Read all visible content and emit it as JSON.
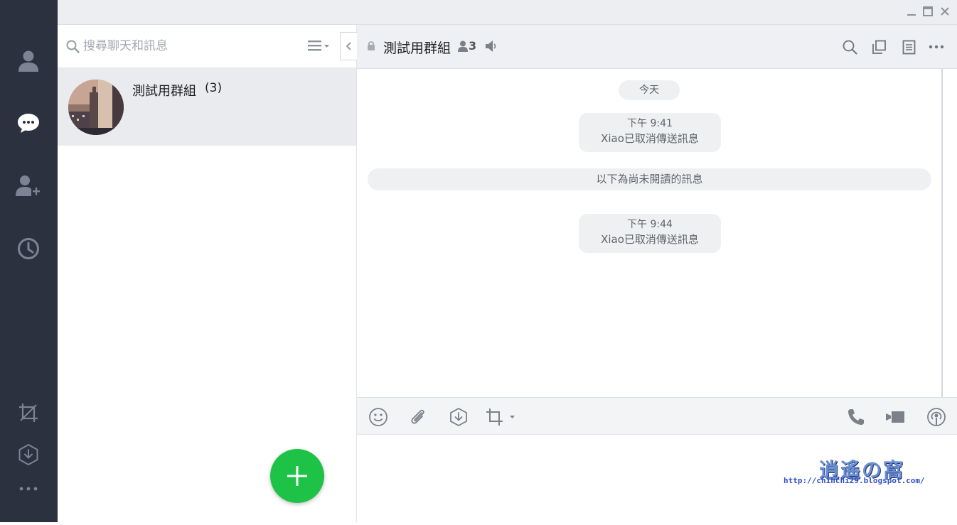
{
  "colors": {
    "sidebar_bg": "#2c3140",
    "sidebar_icon": "#7d8393",
    "sidebar_icon_active": "#ffffff",
    "fab_green": "#1dc247",
    "selected_row": "#e9ebee",
    "system_bubble": "#eef0f2"
  },
  "sidebar": {
    "items": [
      {
        "icon": "friends-icon",
        "active": false
      },
      {
        "icon": "chat-bubble-icon",
        "active": true
      },
      {
        "icon": "add-friend-icon",
        "active": false
      },
      {
        "icon": "clock-icon",
        "active": false
      }
    ],
    "bottom_items": [
      {
        "icon": "crop-capture-icon"
      },
      {
        "icon": "keep-download-icon"
      },
      {
        "icon": "more-dots-icon"
      }
    ]
  },
  "window": {
    "buttons": [
      "minimize-icon",
      "maximize-icon",
      "close-icon"
    ]
  },
  "chat_list": {
    "search": {
      "placeholder": "搜尋聊天和訊息"
    },
    "items": [
      {
        "name": "測試用群組",
        "count": "(3)",
        "selected": true
      }
    ],
    "fab_label": "+"
  },
  "chat": {
    "title": "測試用群組",
    "member_count": "3",
    "header_icons": [
      "search-icon",
      "copy-window-icon",
      "notes-icon",
      "more-icon"
    ],
    "date_separator": "今天",
    "messages": [
      {
        "time": "下午 9:41",
        "text": "Xiao已取消傳送訊息"
      },
      {
        "time": "下午 9:44",
        "text": "Xiao已取消傳送訊息"
      }
    ],
    "unread_divider": "以下為尚未閱讀的訊息",
    "toolbar": {
      "left": [
        "emoji-icon",
        "attach-file-icon",
        "keep-save-icon",
        "screenshot-crop-icon"
      ],
      "right": [
        "voice-call-icon",
        "video-call-icon",
        "live-broadcast-icon"
      ]
    }
  },
  "watermark": {
    "logo_text": "逍遙の窩",
    "url": "http://chihchi29.blogspot.com/"
  }
}
